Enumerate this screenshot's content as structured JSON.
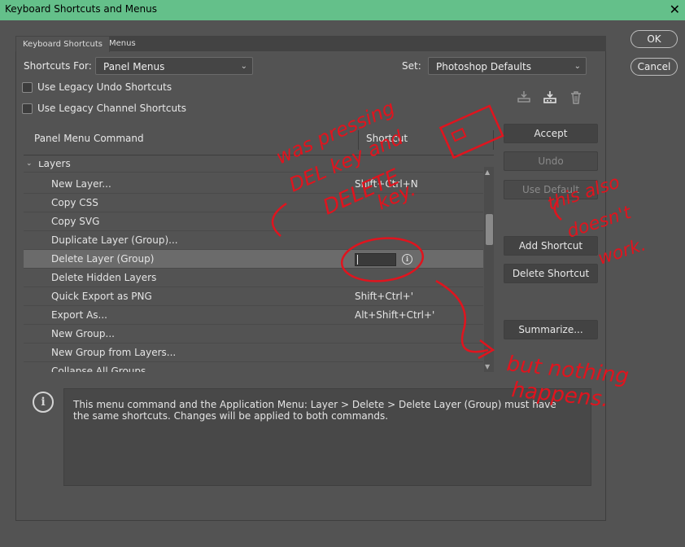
{
  "window": {
    "title": "Keyboard Shortcuts and Menus",
    "close": "✕"
  },
  "tabs": [
    {
      "label": "Keyboard Shortcuts",
      "active": true
    },
    {
      "label": "Menus",
      "active": false
    }
  ],
  "controls": {
    "shortcuts_for_label": "Shortcuts For:",
    "shortcuts_for_value": "Panel Menus",
    "set_label": "Set:",
    "set_value": "Photoshop Defaults",
    "legacy_undo": "Use Legacy Undo Shortcuts",
    "legacy_channel": "Use Legacy Channel Shortcuts"
  },
  "table": {
    "col_command": "Panel Menu Command",
    "col_shortcut": "Shortcut",
    "group": "Layers",
    "rows": [
      {
        "command": "New Layer...",
        "shortcut": "Shift+Ctrl+N"
      },
      {
        "command": "Copy CSS",
        "shortcut": ""
      },
      {
        "command": "Copy SVG",
        "shortcut": ""
      },
      {
        "command": "Duplicate Layer (Group)...",
        "shortcut": ""
      },
      {
        "command": "Delete Layer (Group)",
        "shortcut": ""
      },
      {
        "command": "Delete Hidden Layers",
        "shortcut": ""
      },
      {
        "command": "Quick Export as PNG",
        "shortcut": "Shift+Ctrl+'"
      },
      {
        "command": "Export As...",
        "shortcut": "Alt+Shift+Ctrl+'"
      },
      {
        "command": "New Group...",
        "shortcut": ""
      },
      {
        "command": "New Group from Layers...",
        "shortcut": ""
      },
      {
        "command": "Collapse All Groups",
        "shortcut": ""
      }
    ],
    "selected_index": 4
  },
  "buttons": {
    "ok": "OK",
    "cancel": "Cancel",
    "accept": "Accept",
    "undo": "Undo",
    "use_default": "Use Default",
    "add_shortcut": "Add Shortcut",
    "delete_shortcut": "Delete Shortcut",
    "summarize": "Summarize..."
  },
  "info": {
    "text": "This menu command and the Application Menu: Layer > Delete > Delete Layer (Group) must have the same shortcuts.  Changes will be applied to both commands."
  },
  "annotations": {
    "note1_line1": "was pressing",
    "note1_line2": "DEL key and",
    "note1_line3": "DELETE",
    "note1_line4": "key.",
    "note2_line1": "this also",
    "note2_line2": "doesn't",
    "note2_line3": "work.",
    "note3_line1": "but nothing",
    "note3_line2": "happens."
  }
}
